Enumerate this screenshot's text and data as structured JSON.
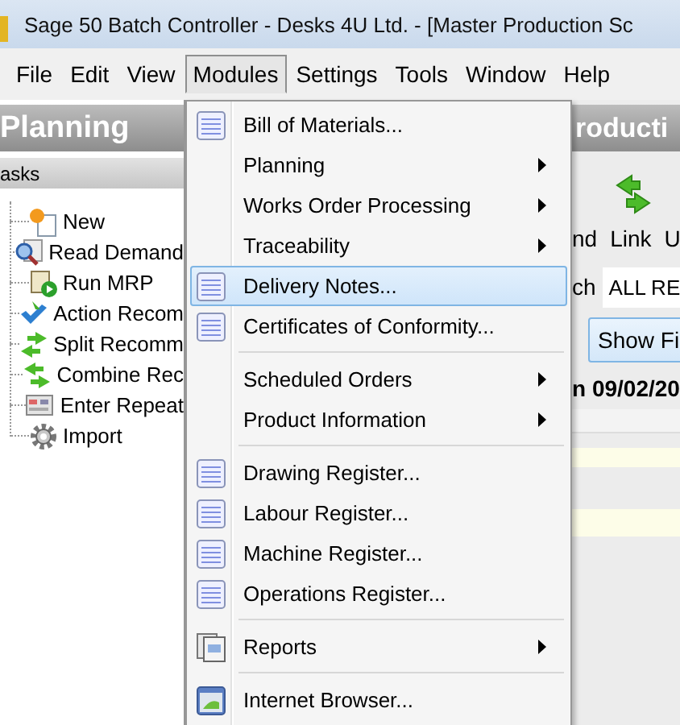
{
  "window": {
    "title": "Sage 50 Batch Controller - Desks 4U Ltd. - [Master Production Sc"
  },
  "menu_bar": [
    {
      "label": "File",
      "selected": false
    },
    {
      "label": "Edit",
      "selected": false
    },
    {
      "label": "View",
      "selected": false
    },
    {
      "label": "Modules",
      "selected": true
    },
    {
      "label": "Settings",
      "selected": false
    },
    {
      "label": "Tools",
      "selected": false
    },
    {
      "label": "Window",
      "selected": false
    },
    {
      "label": "Help",
      "selected": false
    }
  ],
  "left_panel": {
    "title": "Planning",
    "section": "asks",
    "items": [
      {
        "label": "New",
        "kind": "new"
      },
      {
        "label": "Read Demand",
        "kind": "read"
      },
      {
        "label": "Run MRP",
        "kind": "run"
      },
      {
        "label": "Action Recom",
        "kind": "action"
      },
      {
        "label": "Split Recomm",
        "kind": "split"
      },
      {
        "label": "Combine Rec",
        "kind": "combine"
      },
      {
        "label": "Enter Repeat",
        "kind": "repeat"
      },
      {
        "label": "Import",
        "kind": "import"
      }
    ]
  },
  "right_panel": {
    "title": "roducti",
    "toolbar_labels": [
      "nd",
      "Link",
      "U"
    ],
    "filter_label": "ch",
    "filter_value": "ALL RE",
    "show_button": "Show Fi",
    "date_label": "n 09/02/20"
  },
  "dropdown": {
    "items": [
      {
        "kind": "command",
        "label": "Bill of Materials...",
        "selected": false
      },
      {
        "kind": "submenu",
        "label": "Planning",
        "selected": false
      },
      {
        "kind": "submenu",
        "label": "Works Order Processing",
        "selected": false
      },
      {
        "kind": "submenu",
        "label": "Traceability",
        "selected": false
      },
      {
        "kind": "command",
        "label": "Delivery Notes...",
        "selected": true
      },
      {
        "kind": "command",
        "label": "Certificates of Conformity...",
        "selected": false
      },
      {
        "kind": "separator"
      },
      {
        "kind": "submenu",
        "label": "Scheduled Orders",
        "selected": false
      },
      {
        "kind": "submenu",
        "label": "Product Information",
        "selected": false
      },
      {
        "kind": "separator"
      },
      {
        "kind": "command",
        "label": "Drawing Register...",
        "selected": false
      },
      {
        "kind": "command",
        "label": "Labour Register...",
        "selected": false
      },
      {
        "kind": "command",
        "label": "Machine Register...",
        "selected": false
      },
      {
        "kind": "command",
        "label": "Operations Register...",
        "selected": false
      },
      {
        "kind": "separator"
      },
      {
        "kind": "reports",
        "label": "Reports",
        "selected": false
      },
      {
        "kind": "separator"
      },
      {
        "kind": "browser",
        "label": "Internet Browser...",
        "selected": false
      }
    ]
  }
}
